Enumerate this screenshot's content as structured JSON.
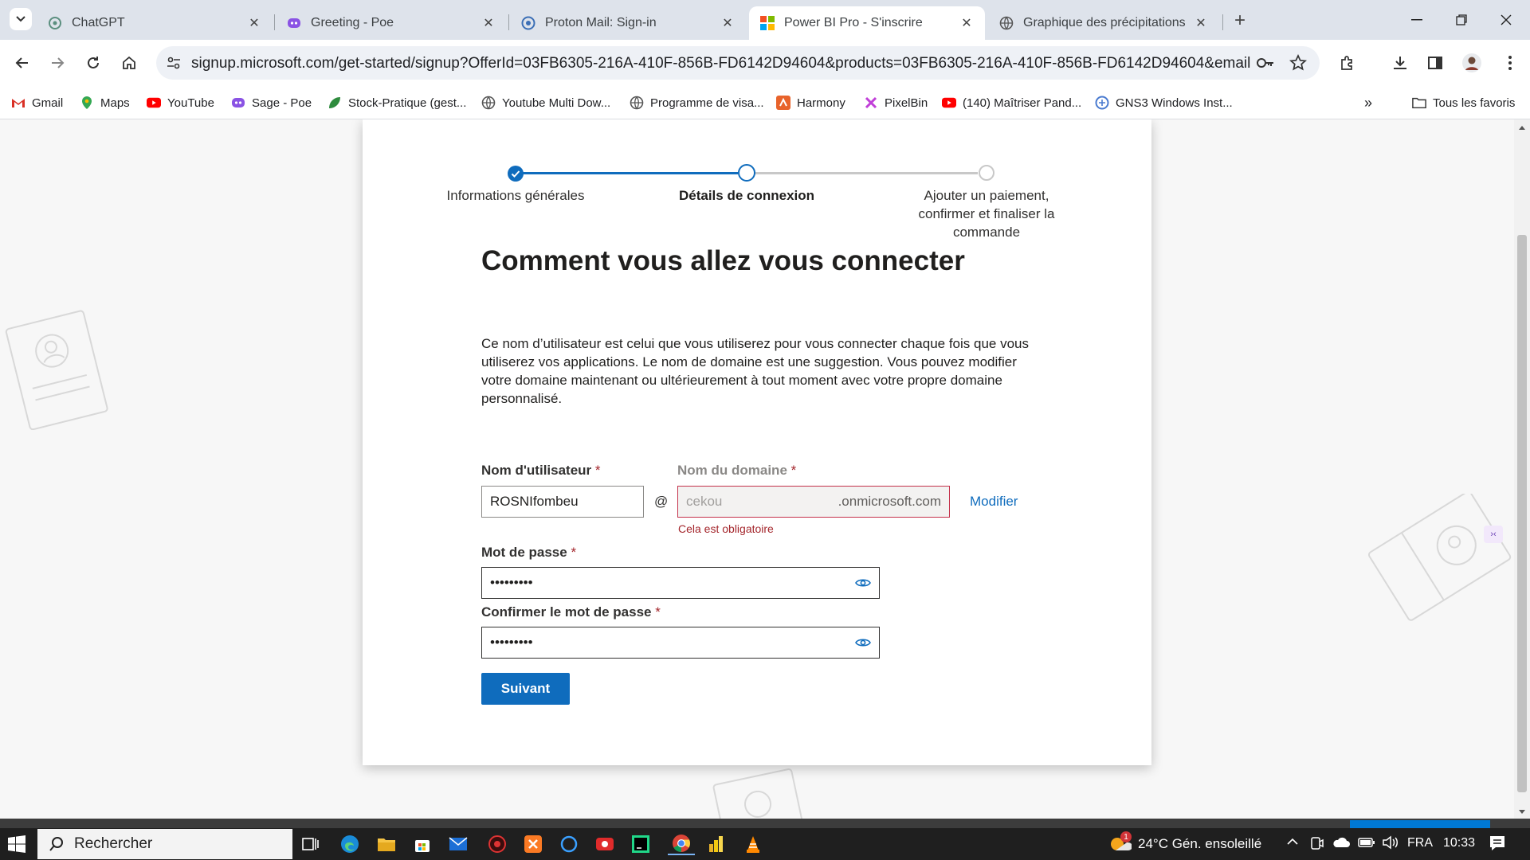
{
  "browser": {
    "tabs": [
      {
        "title": "ChatGPT",
        "icon": "chatgpt-icon",
        "active": false
      },
      {
        "title": "Greeting - Poe",
        "icon": "poe-icon",
        "active": false
      },
      {
        "title": "Proton Mail: Sign-in",
        "icon": "proton-icon",
        "active": false
      },
      {
        "title": "Power BI Pro - S'inscrire",
        "icon": "microsoft-icon",
        "active": true
      },
      {
        "title": "Graphique des précipitations",
        "icon": "globe-icon",
        "active": false
      }
    ],
    "url": "signup.microsoft.com/get-started/signup?OfferId=03FB6305-216A-410F-856B-FD6142D94604&products=03FB6305-216A-410F-856B-FD6142D94604&email=zidanerosni...",
    "bookmarks": [
      {
        "label": "Gmail",
        "icon": "gmail-icon"
      },
      {
        "label": "Maps",
        "icon": "maps-icon"
      },
      {
        "label": "YouTube",
        "icon": "youtube-icon"
      },
      {
        "label": "Sage - Poe",
        "icon": "poe-icon"
      },
      {
        "label": "Stock-Pratique (gest...",
        "icon": "leaf-icon"
      },
      {
        "label": "Youtube Multi Dow...",
        "icon": "globe-icon"
      },
      {
        "label": "Programme de visa...",
        "icon": "globe-icon"
      },
      {
        "label": "Harmony",
        "icon": "harmony-icon"
      },
      {
        "label": "PixelBin",
        "icon": "pixelbin-icon"
      },
      {
        "label": "(140) Maîtriser Pand...",
        "icon": "youtube-icon"
      },
      {
        "label": "GNS3 Windows Inst...",
        "icon": "gns3-icon"
      }
    ],
    "all_bookmarks": "Tous les favoris"
  },
  "signup": {
    "steps": [
      {
        "label": "Informations générales",
        "state": "done"
      },
      {
        "label": "Détails de connexion",
        "state": "current"
      },
      {
        "label": "Ajouter un paiement, confirmer et finaliser la commande",
        "state": "todo"
      }
    ],
    "title": "Comment vous allez vous connecter",
    "description": "Ce nom d’utilisateur est celui que vous utiliserez pour vous connecter chaque fois que vous utiliserez vos applications. Le nom de domaine est une suggestion. Vous pouvez modifier votre domaine maintenant ou ultérieurement à tout moment avec votre propre domaine personnalisé.",
    "username_label": "Nom d'utilisateur",
    "username_value": "ROSNIfombeu",
    "at_sign": "@",
    "domain_label": "Nom du domaine",
    "domain_placeholder": "cekou",
    "domain_suffix": ".onmicrosoft.com",
    "domain_error": "Cela est obligatoire",
    "modify_link": "Modifier",
    "password_label": "Mot de passe",
    "password_value": "•••••••••",
    "confirm_label": "Confirmer le mot de passe",
    "confirm_value": "•••••••••",
    "required_mark": "*",
    "next_button": "Suivant"
  },
  "taskbar": {
    "search_placeholder": "Rechercher",
    "weather": "24°C  Gén. ensoleillé",
    "weather_badge": "1",
    "language": "FRA",
    "time": "10:33"
  },
  "colors": {
    "accent": "#0f6cbd",
    "error": "#a4262c"
  }
}
